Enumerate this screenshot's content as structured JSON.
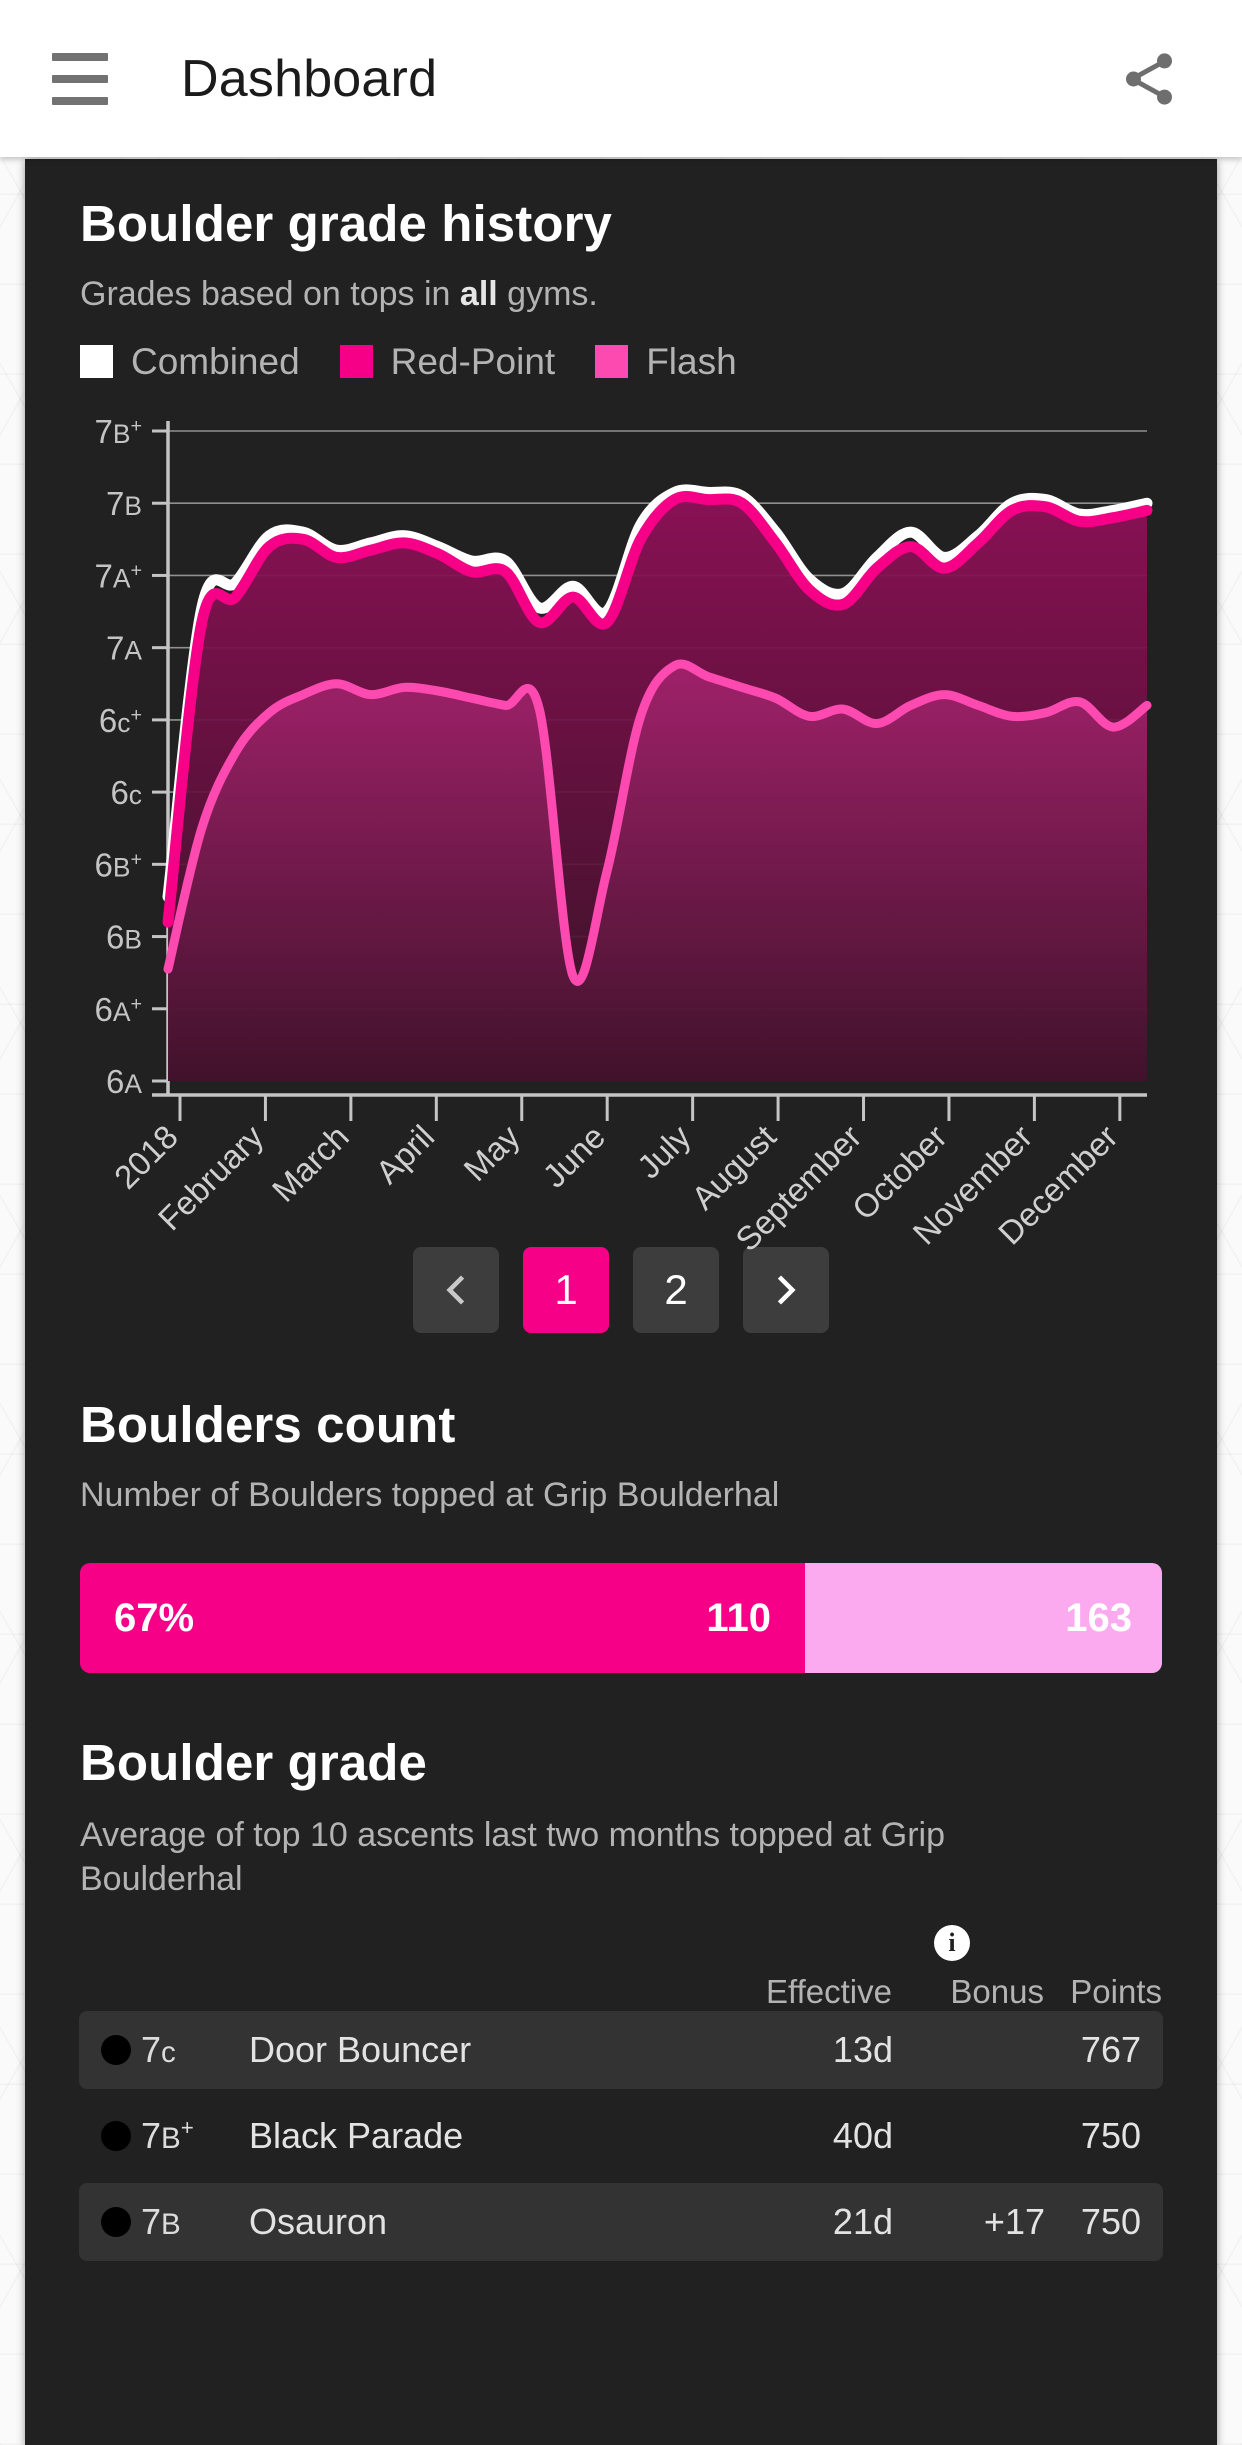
{
  "appbar": {
    "menu_icon": "hamburger-menu-icon",
    "title": "Dashboard",
    "share_icon": "share-icon"
  },
  "grade_history": {
    "title": "Boulder grade history",
    "subtitle_pre": "Grades based on tops in ",
    "subtitle_bold": "all",
    "subtitle_post": " gyms.",
    "legend": [
      {
        "label": "Combined",
        "color": "#ffffff"
      },
      {
        "label": "Red-Point",
        "color": "#f50087"
      },
      {
        "label": "Flash",
        "color": "#fc4ab0"
      }
    ],
    "pagination": {
      "prev_icon": "chevron-left-icon",
      "next_icon": "chevron-right-icon",
      "pages": [
        "1",
        "2"
      ],
      "active_page": "1"
    }
  },
  "chart_data": {
    "type": "line",
    "title": "Boulder grade history",
    "xlabel": "",
    "ylabel": "",
    "grid": true,
    "legend_position": "top",
    "x": [
      "2018",
      "February",
      "March",
      "April",
      "May",
      "June",
      "July",
      "August",
      "September",
      "October",
      "November",
      "December"
    ],
    "ytick_labels": [
      "6A",
      "6A+",
      "6B",
      "6B+",
      "6c",
      "6c+",
      "7A",
      "7A+",
      "7B",
      "7B+"
    ],
    "ylim": [
      0,
      9
    ],
    "series": [
      {
        "name": "Combined",
        "color": "#ffffff",
        "values": [
          2.55,
          6.55,
          6.9,
          7.55,
          7.6,
          7.35,
          7.45,
          7.55,
          7.4,
          7.2,
          7.2,
          6.55,
          6.85,
          6.5,
          7.7,
          8.15,
          8.15,
          8.1,
          7.6,
          6.95,
          6.75,
          7.25,
          7.6,
          7.25,
          7.55,
          8.0,
          8.05,
          7.85,
          7.9,
          8.0
        ]
      },
      {
        "name": "Red-Point",
        "color": "#f50087",
        "values": [
          2.2,
          6.35,
          6.7,
          7.4,
          7.5,
          7.25,
          7.35,
          7.45,
          7.3,
          7.05,
          7.05,
          6.35,
          6.7,
          6.35,
          7.5,
          8.05,
          8.05,
          8.0,
          7.45,
          6.8,
          6.6,
          7.1,
          7.4,
          7.1,
          7.45,
          7.9,
          7.95,
          7.75,
          7.8,
          7.9
        ]
      },
      {
        "name": "Flash",
        "color": "#fc4ab0",
        "values": [
          1.55,
          3.5,
          4.55,
          5.1,
          5.35,
          5.5,
          5.35,
          5.45,
          5.4,
          5.3,
          5.2,
          5.15,
          1.45,
          2.9,
          5.05,
          5.75,
          5.6,
          5.45,
          5.3,
          5.05,
          5.15,
          4.95,
          5.2,
          5.35,
          5.2,
          5.05,
          5.1,
          5.25,
          4.9,
          5.2
        ]
      }
    ]
  },
  "boulders_count": {
    "title": "Boulders count",
    "subtitle": "Number of Boulders topped at Grip Boulderhal",
    "percent_label": "67%",
    "percent_value": 67,
    "filled_value": "110",
    "total_value": "163",
    "filled_color": "#f50087",
    "rest_color": "#fbaaf0"
  },
  "boulder_grade": {
    "title": "Boulder grade",
    "subtitle": "Average of top 10 ascents last two months topped at Grip Boulderhal",
    "info_icon": "info-icon",
    "columns": {
      "effective": "Effective",
      "bonus": "Bonus",
      "points": "Points"
    },
    "rows": [
      {
        "grade_main": "7",
        "grade_sub": "c",
        "grade_sup": "",
        "name": "Door Bouncer",
        "effective": "13d",
        "bonus": "",
        "points": "767"
      },
      {
        "grade_main": "7",
        "grade_sub": "B",
        "grade_sup": "+",
        "name": "Black Parade",
        "effective": "40d",
        "bonus": "",
        "points": "750"
      },
      {
        "grade_main": "7",
        "grade_sub": "B",
        "grade_sup": "",
        "name": "Osauron",
        "effective": "21d",
        "bonus": "+17",
        "points": "750"
      }
    ]
  }
}
